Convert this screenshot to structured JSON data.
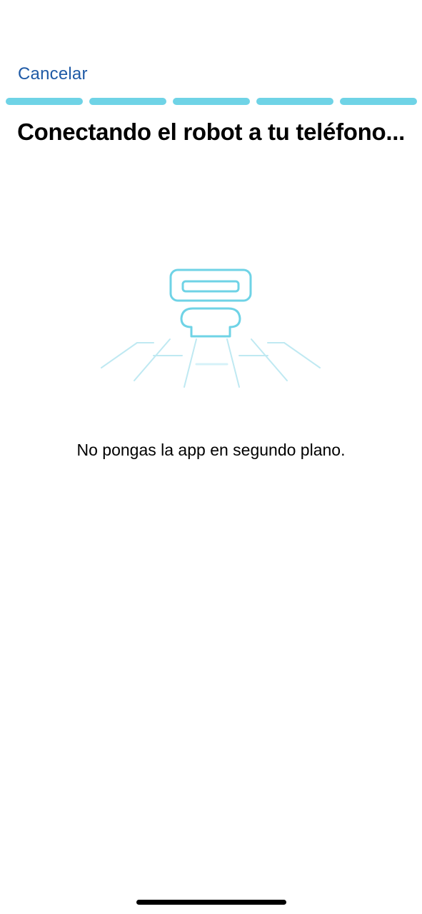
{
  "header": {
    "cancel_label": "Cancelar"
  },
  "progress": {
    "completed_steps": 5,
    "total_steps": 5,
    "color": "#6fd3e6"
  },
  "main": {
    "title": "Conectando el robot a tu teléfono...",
    "illustration_icon": "robot-connecting-icon",
    "hint": "No pongas la app en segundo plano."
  },
  "colors": {
    "accent_link": "#1f5aa6",
    "illustration_cyan": "#6fd3e6"
  }
}
